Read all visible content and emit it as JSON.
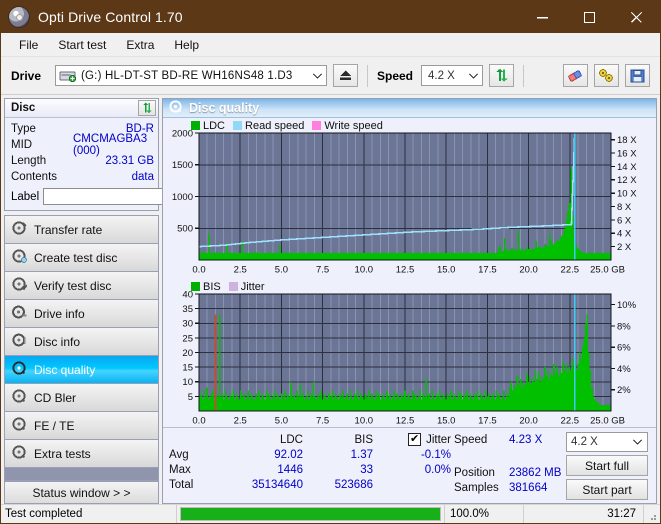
{
  "window": {
    "title": "Opti Drive Control 1.70",
    "title_icon": "disc-icon",
    "minimize": "─",
    "maximize": "□",
    "close": "✕",
    "titlebar_color": "#5c3817"
  },
  "menu": {
    "items": [
      "File",
      "Start test",
      "Extra",
      "Help"
    ]
  },
  "toolbar": {
    "drive_label": "Drive",
    "drive_value": "(G:)  HL-DT-ST BD-RE  WH16NS48 1.D3",
    "eject_icon": "eject-icon",
    "speed_label": "Speed",
    "speed_value": "4.2 X",
    "refresh_icon": "refresh-icon",
    "erase_icon": "eraser-icon",
    "tools_icon": "tools-icon",
    "save_icon": "save-icon",
    "chevron": "⌵"
  },
  "disc_panel": {
    "header": "Disc",
    "refresh_icon": "refresh-icon",
    "rows": [
      {
        "key": "Type",
        "value": "BD-R"
      },
      {
        "key": "MID",
        "value": "CMCMAGBA3 (000)"
      },
      {
        "key": "Length",
        "value": "23.31 GB"
      },
      {
        "key": "Contents",
        "value": "data"
      }
    ],
    "label_key": "Label",
    "label_value": "",
    "label_placeholder": "",
    "label_button_icon": "disc-icon"
  },
  "nav": {
    "items": [
      {
        "label": "Transfer rate",
        "icon": "disc-speed-icon",
        "selected": false
      },
      {
        "label": "Create test disc",
        "icon": "disc-write-icon",
        "selected": false
      },
      {
        "label": "Verify test disc",
        "icon": "disc-verify-icon",
        "selected": false
      },
      {
        "label": "Drive info",
        "icon": "drive-info-icon",
        "selected": false
      },
      {
        "label": "Disc info",
        "icon": "disc-info-icon",
        "selected": false
      },
      {
        "label": "Disc quality",
        "icon": "disc-quality-icon",
        "selected": true
      },
      {
        "label": "CD Bler",
        "icon": "disc-bler-icon",
        "selected": false
      },
      {
        "label": "FE / TE",
        "icon": "disc-fete-icon",
        "selected": false
      },
      {
        "label": "Extra tests",
        "icon": "disc-extra-icon",
        "selected": false
      }
    ],
    "status_window": "Status window > >"
  },
  "main": {
    "header": "Disc quality",
    "header_icon": "disc-quality-icon"
  },
  "stats": {
    "col_headers": [
      "",
      "LDC",
      "BIS",
      "Jitter"
    ],
    "jitter_checked": true,
    "jitter_check_glyph": "✔",
    "rows": [
      {
        "name": "Avg",
        "ldc": "92.02",
        "bis": "1.37",
        "jitter": "-0.1%"
      },
      {
        "name": "Max",
        "ldc": "1446",
        "bis": "33",
        "jitter": "0.0%"
      },
      {
        "name": "Total",
        "ldc": "35134640",
        "bis": "523686",
        "jitter": ""
      }
    ],
    "speed_key": "Speed",
    "speed_value": "4.23 X",
    "position_key": "Position",
    "position_value": "23862 MB",
    "samples_key": "Samples",
    "samples_value": "381664",
    "speed_select": "4.2 X",
    "start_full": "Start full",
    "start_part": "Start part"
  },
  "statusbar": {
    "text": "Test completed",
    "percent": "100.0%",
    "progress": 100,
    "time": "31:27",
    "progress_color": "#18b018"
  },
  "chart_data": [
    {
      "type": "area",
      "title": "LDC / speed",
      "xlabel": "GB",
      "ylabel": "LDC",
      "x_ticks": [
        "0.0",
        "2.5",
        "5.0",
        "7.5",
        "10.0",
        "12.5",
        "15.0",
        "17.5",
        "20.0",
        "22.5",
        "25.0 GB"
      ],
      "xlim": [
        0,
        25
      ],
      "ylim": [
        0,
        2000
      ],
      "y_ticks": [
        "500",
        "1000",
        "1500",
        "2000"
      ],
      "y2_ticks": [
        "2 X",
        "4 X",
        "6 X",
        "8 X",
        "10 X",
        "12 X",
        "14 X",
        "16 X",
        "18 X"
      ],
      "y2lim": [
        0,
        19
      ],
      "legend": [
        {
          "label": "LDC",
          "color": "#00b000"
        },
        {
          "label": "Read speed",
          "color": "#8fd8f7"
        },
        {
          "label": "Write speed",
          "color": "#ff7fe0"
        }
      ],
      "grid": true,
      "plot_bg": "#6b7596",
      "series": [
        {
          "name": "LDC",
          "color": "#00c000",
          "type": "impulse",
          "values": [
            120,
            95,
            110,
            140,
            100,
            90,
            420,
            105,
            115,
            95,
            80,
            130,
            90,
            105,
            85,
            95,
            110,
            90,
            270,
            100,
            115,
            95,
            105,
            120,
            90,
            100,
            110,
            95,
            300,
            90,
            105,
            120,
            85,
            95,
            110,
            100,
            90,
            130,
            95,
            105,
            85,
            95,
            100,
            110,
            90,
            95,
            105,
            115,
            90,
            100,
            95,
            105,
            110,
            230,
            95,
            90,
            100,
            115,
            105,
            95,
            120,
            100,
            90,
            110,
            100,
            95,
            105,
            90,
            100,
            115,
            95,
            105,
            90,
            100,
            110,
            95,
            100,
            90,
            105,
            95,
            110,
            100,
            95,
            105,
            90,
            100,
            95,
            110,
            100,
            90,
            105,
            95,
            100,
            110,
            95,
            100,
            90,
            105,
            95,
            100,
            110,
            95,
            100,
            90,
            105,
            115,
            95,
            100,
            110,
            95,
            105,
            90,
            100,
            95,
            110,
            100,
            95,
            105,
            90,
            110,
            95,
            100,
            105,
            90,
            100,
            95,
            110,
            105,
            95,
            100,
            90,
            105,
            110,
            95,
            100,
            115,
            95,
            105,
            100,
            90,
            110,
            95,
            100,
            105,
            95,
            110,
            100,
            95,
            105,
            90,
            100,
            110,
            95,
            105,
            100,
            95,
            110,
            100,
            105,
            95,
            110,
            100,
            115,
            105,
            95,
            110,
            100,
            105,
            115,
            100,
            95,
            110,
            105,
            100,
            115,
            105,
            95,
            110,
            100,
            105,
            95,
            115,
            105,
            110,
            100,
            105,
            115,
            100,
            110,
            105,
            95,
            110,
            100,
            115,
            105,
            110,
            100,
            115,
            200,
            230,
            130,
            140,
            350,
            150,
            170,
            140,
            160,
            200,
            150,
            170,
            140,
            460,
            150,
            180,
            160,
            170,
            150,
            200,
            170,
            190,
            160,
            180,
            170,
            300,
            200,
            220,
            190,
            210,
            180,
            250,
            230,
            210,
            420,
            300,
            260,
            240,
            280,
            320,
            300,
            340,
            380,
            420,
            500,
            620,
            760,
            900,
            1446,
            700,
            420,
            260,
            200,
            170,
            150,
            130,
            120,
            110,
            100,
            95,
            90,
            85,
            80,
            75,
            70,
            65,
            60,
            55,
            50,
            45,
            40,
            38,
            35,
            33,
            30
          ]
        }
      ],
      "read_speed_line": {
        "name": "Read speed",
        "color": "#9fe0fb",
        "points": [
          [
            0,
            2.0
          ],
          [
            1.5,
            2.2
          ],
          [
            3,
            2.6
          ],
          [
            5,
            3.0
          ],
          [
            7,
            3.3
          ],
          [
            9,
            3.6
          ],
          [
            11,
            3.9
          ],
          [
            13,
            4.2
          ],
          [
            15,
            4.4
          ],
          [
            17,
            4.6
          ],
          [
            19,
            4.9
          ],
          [
            21,
            5.1
          ],
          [
            22.6,
            5.3
          ],
          [
            22.8,
            19
          ]
        ]
      },
      "annotations": [
        {
          "type": "vline",
          "x": 22.8,
          "color": "#3ecdf4"
        }
      ]
    },
    {
      "type": "area",
      "title": "BIS / jitter",
      "xlabel": "GB",
      "ylabel": "BIS",
      "x_ticks": [
        "0.0",
        "2.5",
        "5.0",
        "7.5",
        "10.0",
        "12.5",
        "15.0",
        "17.5",
        "20.0",
        "22.5",
        "25.0 GB"
      ],
      "xlim": [
        0,
        25
      ],
      "ylim": [
        0,
        40
      ],
      "y_ticks": [
        "5",
        "10",
        "15",
        "20",
        "25",
        "30",
        "35",
        "40"
      ],
      "y2_ticks": [
        "2%",
        "4%",
        "6%",
        "8%",
        "10%"
      ],
      "y2lim": [
        0,
        11
      ],
      "legend": [
        {
          "label": "BIS",
          "color": "#00b000"
        },
        {
          "label": "Jitter",
          "color": "#cdb3dd"
        }
      ],
      "grid": true,
      "plot_bg": "#6b7596",
      "series": [
        {
          "name": "BIS",
          "color": "#00c000",
          "type": "impulse",
          "values": [
            5,
            6,
            4,
            7,
            5,
            8,
            4,
            6,
            5,
            7,
            4,
            6,
            5,
            33,
            5,
            6,
            4,
            7,
            5,
            4,
            6,
            5,
            7,
            4,
            6,
            5,
            4,
            7,
            5,
            6,
            4,
            5,
            7,
            4,
            6,
            5,
            4,
            6,
            5,
            7,
            4,
            6,
            5,
            4,
            7,
            5,
            6,
            4,
            5,
            7,
            4,
            6,
            5,
            4,
            6,
            5,
            7,
            4,
            6,
            5,
            10,
            5,
            6,
            4,
            7,
            5,
            9,
            5,
            6,
            4,
            5,
            7,
            4,
            6,
            5,
            10,
            5,
            4,
            6,
            5,
            7,
            4,
            6,
            5,
            4,
            6,
            5,
            7,
            4,
            6,
            5,
            4,
            6,
            5,
            7,
            4,
            5,
            6,
            4,
            7,
            5,
            4,
            6,
            5,
            7,
            4,
            6,
            5,
            4,
            6,
            5,
            7,
            4,
            6,
            5,
            4,
            7,
            5,
            6,
            4,
            5,
            6,
            4,
            7,
            5,
            6,
            4,
            5,
            7,
            4,
            6,
            5,
            4,
            6,
            5,
            7,
            4,
            6,
            5,
            4,
            7,
            5,
            6,
            4,
            5,
            7,
            4,
            6,
            5,
            11,
            5,
            6,
            4,
            7,
            5,
            4,
            6,
            5,
            7,
            4,
            6,
            5,
            4,
            6,
            5,
            7,
            4,
            6,
            5,
            4,
            7,
            5,
            6,
            4,
            6,
            5,
            7,
            4,
            6,
            5,
            4,
            6,
            5,
            7,
            4,
            6,
            5,
            4,
            7,
            5,
            6,
            4,
            5,
            6,
            4,
            7,
            5,
            6,
            4,
            5,
            7,
            4,
            6,
            5,
            8,
            10,
            7,
            9,
            8,
            12,
            9,
            11,
            8,
            10,
            9,
            13,
            10,
            12,
            9,
            11,
            10,
            14,
            11,
            13,
            10,
            12,
            11,
            15,
            12,
            14,
            11,
            13,
            12,
            16,
            13,
            15,
            12,
            14,
            13,
            17,
            14,
            16,
            13,
            15,
            14,
            18,
            15,
            17,
            14,
            16,
            20,
            18,
            22,
            25,
            30,
            33,
            20,
            14,
            8,
            5,
            4,
            3,
            3,
            2,
            2,
            2,
            2,
            2,
            2,
            2,
            2
          ]
        }
      ],
      "annotations": [
        {
          "type": "vline",
          "x": 1.0,
          "color": "#c0502b",
          "height": 33
        },
        {
          "type": "vline",
          "x": 22.8,
          "color": "#3ecdf4"
        }
      ]
    }
  ]
}
